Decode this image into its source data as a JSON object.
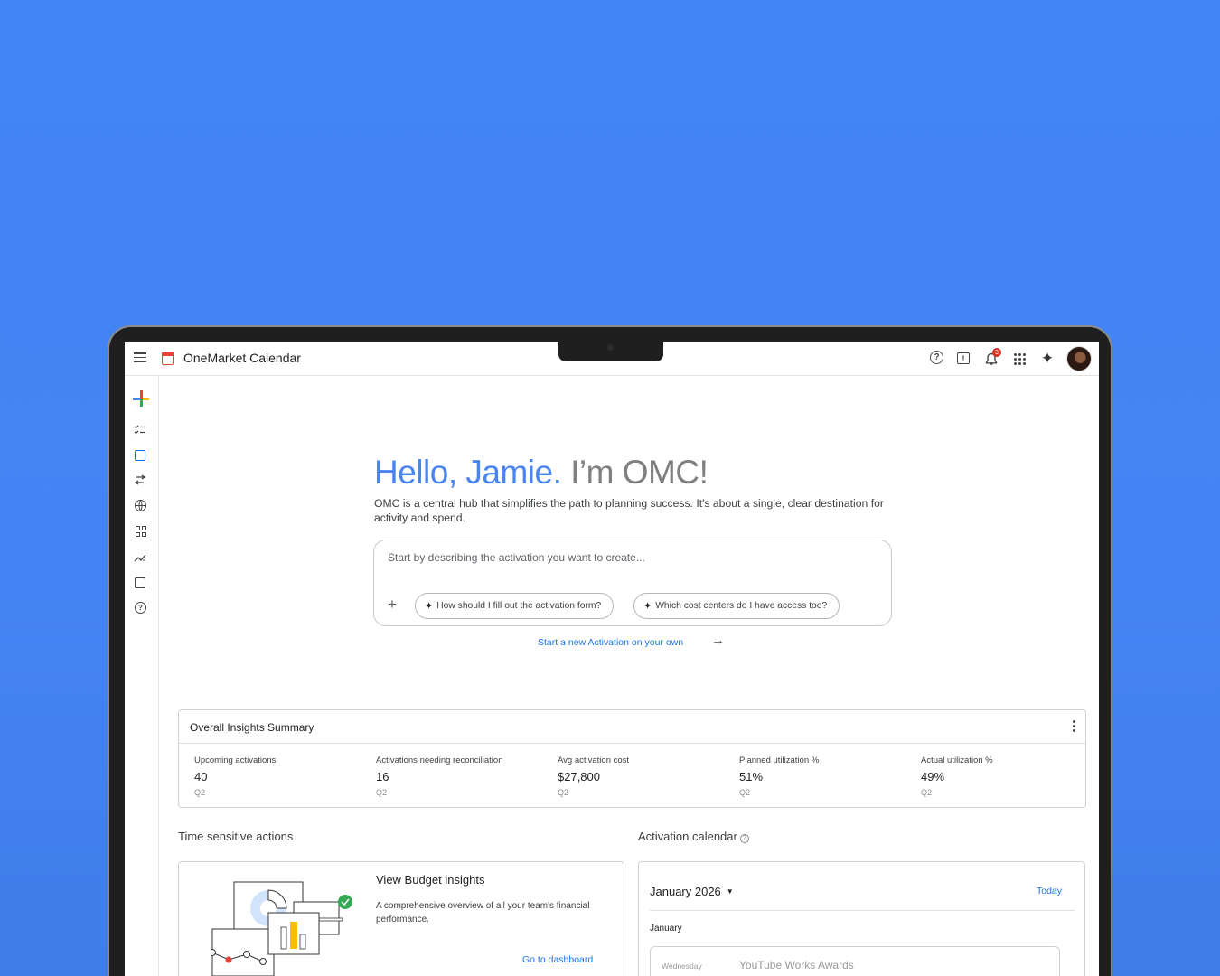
{
  "app": {
    "title": "OneMarket Calendar",
    "notification_count": "3"
  },
  "icons": {
    "topbar": [
      "menu-icon",
      "calendar-logo-icon",
      "help-icon",
      "feedback-icon",
      "notifications-icon",
      "apps-grid-icon",
      "sparkle-icon",
      "avatar"
    ],
    "rail": [
      "create-plus-icon",
      "checklist-icon",
      "calendar-icon",
      "swap-arrows-icon",
      "globe-icon",
      "dashboard-icon",
      "insights-icon",
      "event-calendar-icon",
      "help-icon"
    ]
  },
  "hero": {
    "greeting": "Hello, Jamie.",
    "intro": "I’m OMC!",
    "description": "OMC is a central hub that simplifies the path to planning success. It's about a single, clear destination for activity and spend."
  },
  "prompt": {
    "placeholder": "Start by describing the activation you want to create...",
    "chips": [
      "How should I fill out the activation form?",
      "Which cost centers do I have access too?"
    ],
    "start_link": "Start a new Activation on your own"
  },
  "insights": {
    "title": "Overall Insights Summary",
    "metrics": [
      {
        "label": "Upcoming activations",
        "value": "40",
        "period": "Q2"
      },
      {
        "label": "Activations needing reconciliation",
        "value": "16",
        "period": "Q2"
      },
      {
        "label": "Avg activation cost",
        "value": "$27,800",
        "period": "Q2"
      },
      {
        "label": "Planned utilization %",
        "value": "51%",
        "period": "Q2"
      },
      {
        "label": "Actual utilization %",
        "value": "49%",
        "period": "Q2"
      }
    ]
  },
  "time_sensitive": {
    "section_title": "Time sensitive actions",
    "card_title": "View Budget insights",
    "card_desc": "A comprehensive overview of all your team's financial performance.",
    "card_link": "Go to dashboard"
  },
  "calendar": {
    "section_title": "Activation calendar",
    "month_label": "January 2026",
    "today_label": "Today",
    "month_heading": "January",
    "event": {
      "day": "Wednesday",
      "name": "YouTube Works Awards"
    }
  },
  "colors": {
    "background": "#4285f4",
    "accent_blue": "#1a73e8",
    "greeting_blue": "#4a84f0",
    "badge_red": "#d93025"
  }
}
